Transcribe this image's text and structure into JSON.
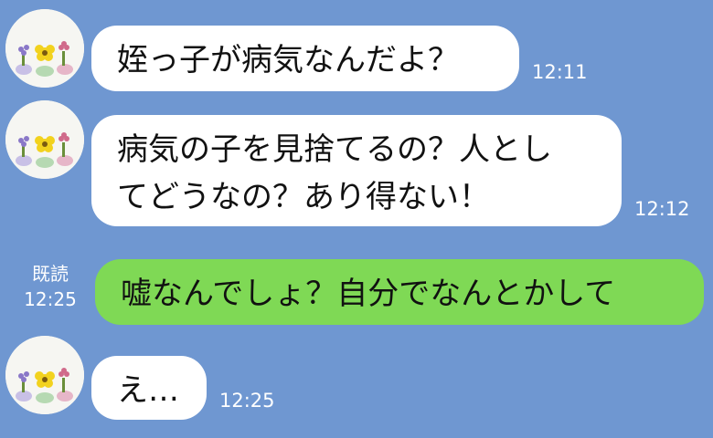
{
  "messages": [
    {
      "direction": "received",
      "text": "姪っ子が病気なんだよ？",
      "time": "12:11",
      "avatar_icon": "flowers-avatar-icon"
    },
    {
      "direction": "received",
      "lines": [
        "病気の子を見捨てるの？人とし",
        "てどうなの？あり得ない！"
      ],
      "time": "12:12",
      "avatar_icon": "flowers-avatar-icon"
    },
    {
      "direction": "sent",
      "text": "嘘なんでしょ？自分でなんとかして",
      "read_label": "既読",
      "time": "12:25"
    },
    {
      "direction": "received",
      "text": "え…",
      "time": "12:25",
      "avatar_icon": "flowers-avatar-icon"
    }
  ],
  "colors": {
    "background": "#6f97d1",
    "received_bubble": "#ffffff",
    "sent_bubble": "#7fd955",
    "text": "#111111",
    "timestamp": "#ffffff"
  }
}
